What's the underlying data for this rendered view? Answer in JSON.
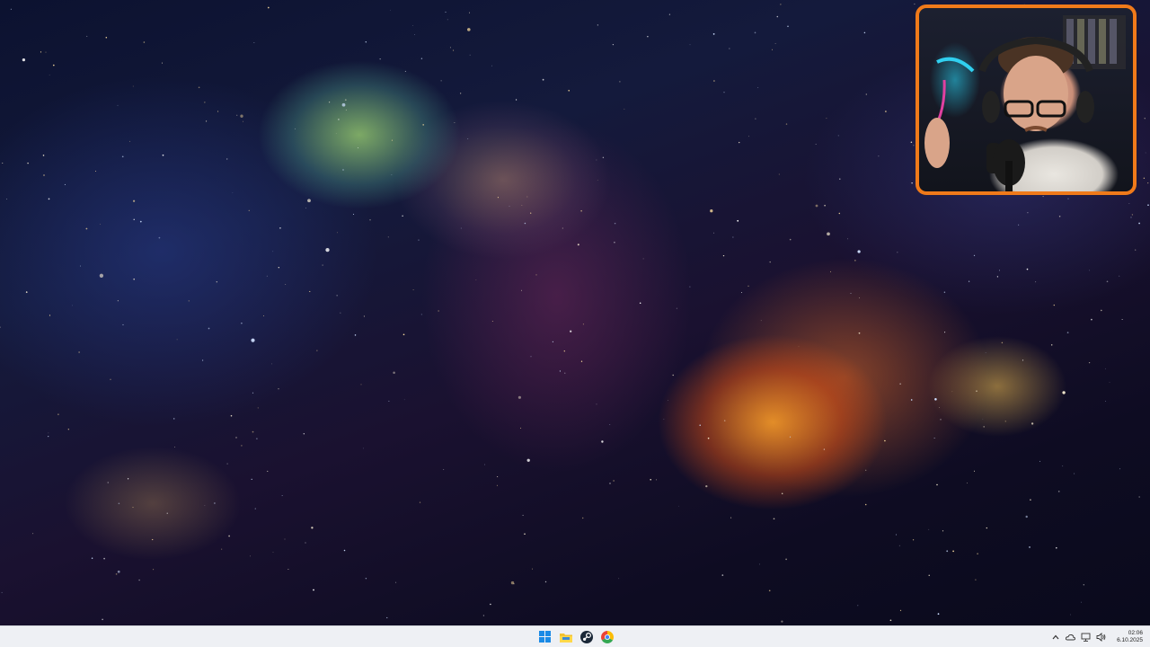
{
  "desktop": {
    "wallpaper": "nebula",
    "accent_colors": {
      "orange_nebula": "#f0a030",
      "green_nebula": "#a8e080",
      "space_blue": "#141a3c"
    }
  },
  "webcam_overlay": {
    "border_color": "#f07a1a"
  },
  "taskbar": {
    "background": "#eef0f4",
    "pinned": [
      {
        "name": "start-button",
        "icon": "windows-icon"
      },
      {
        "name": "file-explorer-button",
        "icon": "folder-icon"
      },
      {
        "name": "steam-button",
        "icon": "steam-icon"
      },
      {
        "name": "chrome-button",
        "icon": "chrome-icon"
      }
    ],
    "tray": {
      "overflow_icon": "chevron-up-icon",
      "icons": [
        "onedrive-icon",
        "network-icon",
        "volume-icon"
      ],
      "time": "02:06",
      "date": "6.10.2025"
    }
  }
}
